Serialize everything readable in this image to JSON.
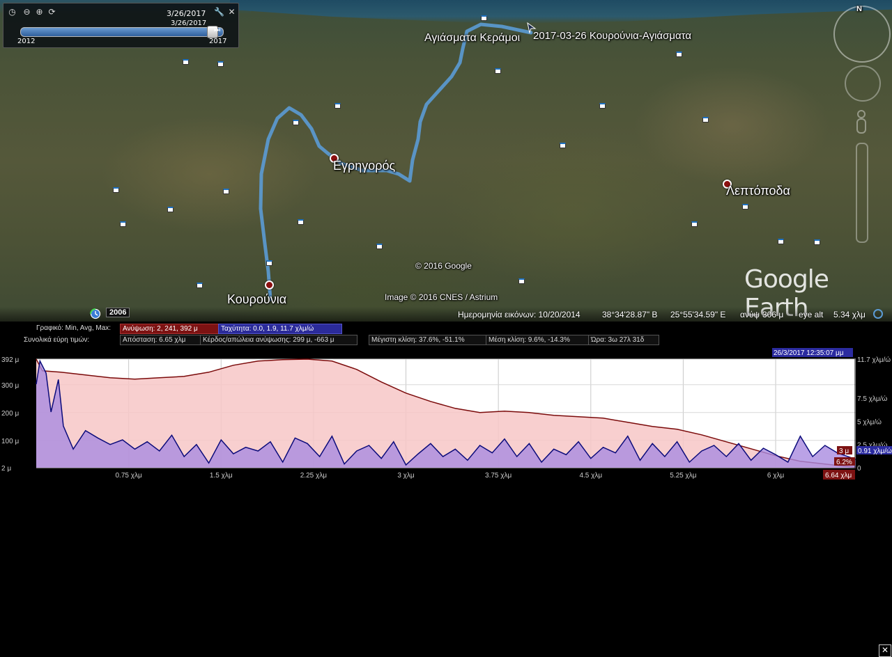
{
  "map": {
    "places": [
      {
        "name": "Αγιάσματα Κεράμοι"
      },
      {
        "name": "2017-03-26 Κουρούνια-Αγιάσματα"
      },
      {
        "name": "Εγρηγορός"
      },
      {
        "name": "Λεπτόποδα"
      },
      {
        "name": "Κουρούνια"
      }
    ],
    "copyright_google": "© 2016 Google",
    "copyright_image": "Image © 2016 CNES / Astrium",
    "brand": "Google Earth",
    "compass_label": "N",
    "historic_year": "2006"
  },
  "timeslider": {
    "date_top": "3/26/2017",
    "date_mid": "3/26/2017",
    "year_start": "2012",
    "year_end": "2017",
    "position": 0.97
  },
  "status": {
    "imagery_date": "Ημερομηνία εικόνων: 10/20/2014",
    "lat": "38°34'28.87\" Β",
    "lon": "25°55'34.59\" Ε",
    "elev_label": "ανύψ",
    "elev_value": "306 μ",
    "eyealt_label": "eye alt",
    "eyealt_value": "5.34 χλμ"
  },
  "profile": {
    "graph_label": "Γραφικό: Min, Avg, Max:",
    "elevation_stats": "Ανύψωση: 2, 241, 392 μ",
    "speed_stats": "Ταχύτητα: 0.0, 1.9, 11.7 χλμ/ώ",
    "summary_label": "Συνολικά εύρη τιμών:",
    "distance": "Απόσταση: 6.65 χλμ",
    "gain_loss": "Κέρδος/απώλεια ανύψωσης: 299 μ, -663 μ",
    "max_slope": "Μέγιστη κλίση: 37.6%, -51.1%",
    "avg_slope": "Μέση κλίση: 9.6%, -14.3%",
    "time": "Ώρα: 3ω 27λ 31δ",
    "cursor_time": "26/3/2017 12:35:07 μμ",
    "cursor_elev": "3 μ",
    "cursor_slope": "6.2%",
    "cursor_speed": "0.91 χλμ/ώ",
    "cursor_distance": "6.64 χλμ",
    "close_symbol": "✕"
  },
  "chart_data": {
    "type": "area",
    "x_ticks": [
      "0.75 χλμ",
      "1.5 χλμ",
      "2.25 χλμ",
      "3 χλμ",
      "3.75 χλμ",
      "4.5 χλμ",
      "5.25 χλμ",
      "6 χλμ"
    ],
    "x_tick_values": [
      0.75,
      1.5,
      2.25,
      3,
      3.75,
      4.5,
      5.25,
      6
    ],
    "xlim": [
      0,
      6.65
    ],
    "y_left_ticks": [
      "392 μ",
      "300 μ",
      "200 μ",
      "100 μ",
      "2 μ"
    ],
    "y_left_values": [
      392,
      300,
      200,
      100,
      2
    ],
    "ylim_left": [
      2,
      392
    ],
    "y_right_ticks": [
      "11.7 χλμ/ώ",
      "7.5 χλμ/ώ",
      "5 χλμ/ώ",
      "2.5 χλμ/ώ",
      "0"
    ],
    "y_right_values": [
      11.7,
      7.5,
      5,
      2.5,
      0
    ],
    "ylim_right": [
      0,
      11.7
    ],
    "series": [
      {
        "color": "#7a0a0a",
        "fill": "#f7c7c7",
        "x": [
          0,
          0.05,
          0.2,
          0.4,
          0.6,
          0.8,
          1.0,
          1.2,
          1.4,
          1.6,
          1.8,
          2.0,
          2.2,
          2.4,
          2.6,
          2.8,
          3.0,
          3.2,
          3.4,
          3.6,
          3.8,
          4.0,
          4.2,
          4.4,
          4.6,
          4.8,
          5.0,
          5.2,
          5.4,
          5.6,
          5.8,
          6.0,
          6.2,
          6.4,
          6.65
        ],
        "y": [
          392,
          350,
          345,
          335,
          325,
          320,
          325,
          330,
          345,
          370,
          385,
          390,
          392,
          385,
          355,
          310,
          270,
          240,
          215,
          200,
          205,
          200,
          190,
          185,
          180,
          165,
          150,
          140,
          120,
          95,
          70,
          45,
          25,
          15,
          3
        ]
      },
      {
        "color": "#0b0b7a",
        "fill": "#a98be0",
        "x": [
          0,
          0.03,
          0.08,
          0.12,
          0.18,
          0.22,
          0.3,
          0.4,
          0.5,
          0.6,
          0.7,
          0.8,
          0.9,
          1.0,
          1.1,
          1.2,
          1.3,
          1.4,
          1.5,
          1.6,
          1.7,
          1.8,
          1.9,
          2.0,
          2.1,
          2.2,
          2.3,
          2.4,
          2.5,
          2.6,
          2.7,
          2.8,
          2.9,
          3.0,
          3.1,
          3.2,
          3.3,
          3.4,
          3.5,
          3.6,
          3.7,
          3.8,
          3.9,
          4.0,
          4.1,
          4.2,
          4.3,
          4.4,
          4.5,
          4.6,
          4.7,
          4.8,
          4.9,
          5.0,
          5.1,
          5.2,
          5.3,
          5.4,
          5.5,
          5.6,
          5.7,
          5.8,
          5.9,
          6.0,
          6.1,
          6.2,
          6.3,
          6.4,
          6.5,
          6.65
        ],
        "y": [
          9,
          11.5,
          10.2,
          6,
          9.5,
          4.5,
          2,
          4,
          3.2,
          2.5,
          3,
          2,
          2.8,
          1.8,
          3.5,
          1.2,
          2.5,
          0.5,
          3,
          1.5,
          2.2,
          1.8,
          2.8,
          0.6,
          3.2,
          2.6,
          1.2,
          3.4,
          0.4,
          1.8,
          2.4,
          1,
          2.8,
          0.3,
          1.5,
          2.6,
          1.2,
          2,
          0.8,
          2.4,
          1.6,
          3.1,
          1.2,
          2.6,
          0.6,
          2,
          1.4,
          2.8,
          1,
          2.2,
          1.6,
          3.4,
          0.8,
          2.6,
          1.2,
          2.8,
          0.6,
          1.8,
          2.4,
          1.2,
          2.6,
          0.8,
          2.1,
          1.4,
          0.6,
          3.4,
          1.2,
          2.4,
          1.6,
          0.91
        ]
      }
    ]
  }
}
